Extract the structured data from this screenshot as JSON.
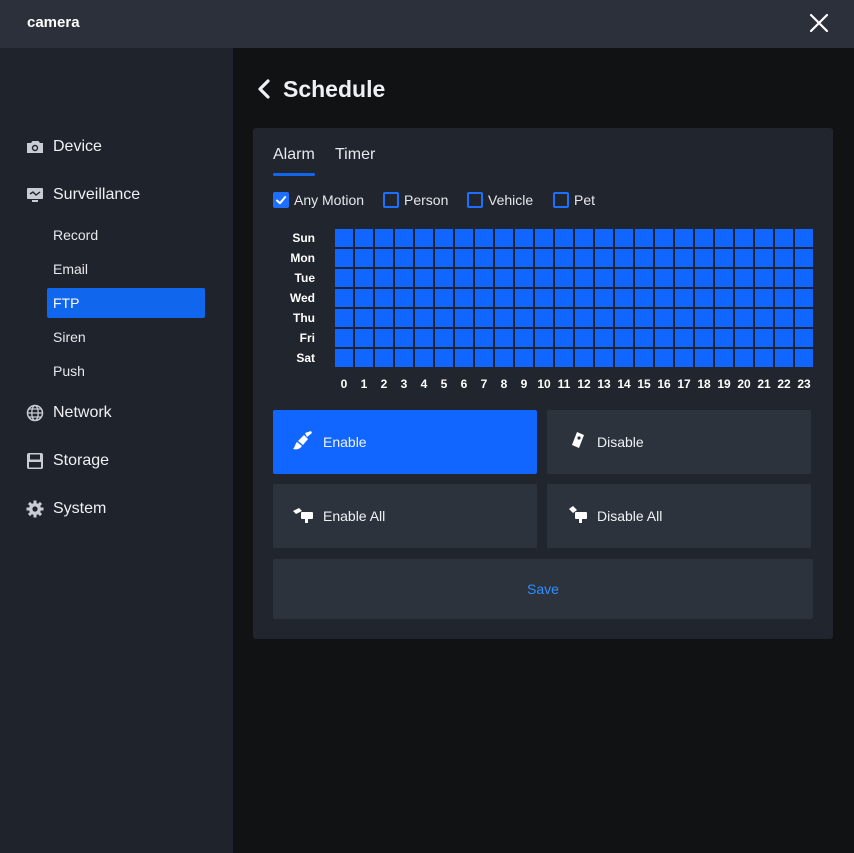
{
  "window": {
    "title": "camera"
  },
  "sidebar": {
    "items": [
      {
        "label": "Device",
        "icon": "camera-icon"
      },
      {
        "label": "Surveillance",
        "icon": "monitor-icon"
      },
      {
        "label": "Network",
        "icon": "globe-icon"
      },
      {
        "label": "Storage",
        "icon": "floppy-disk-icon"
      },
      {
        "label": "System",
        "icon": "gear-icon"
      }
    ],
    "subitems": [
      {
        "label": "Record",
        "active": false
      },
      {
        "label": "Email",
        "active": false
      },
      {
        "label": "FTP",
        "active": true
      },
      {
        "label": "Siren",
        "active": false
      },
      {
        "label": "Push",
        "active": false
      }
    ]
  },
  "page": {
    "title": "Schedule"
  },
  "tabs": [
    {
      "label": "Alarm",
      "active": true
    },
    {
      "label": "Timer",
      "active": false
    }
  ],
  "filters": [
    {
      "label": "Any Motion",
      "checked": true
    },
    {
      "label": "Person",
      "checked": false
    },
    {
      "label": "Vehicle",
      "checked": false
    },
    {
      "label": "Pet",
      "checked": false
    }
  ],
  "schedule": {
    "days": [
      "Sun",
      "Mon",
      "Tue",
      "Wed",
      "Thu",
      "Fri",
      "Sat"
    ],
    "hours": [
      "0",
      "1",
      "2",
      "3",
      "4",
      "5",
      "6",
      "7",
      "8",
      "9",
      "10",
      "11",
      "12",
      "13",
      "14",
      "15",
      "16",
      "17",
      "18",
      "19",
      "20",
      "21",
      "22",
      "23"
    ],
    "all_selected": true
  },
  "actions": {
    "enable": "Enable",
    "disable": "Disable",
    "enable_all": "Enable All",
    "disable_all": "Disable All",
    "save": "Save"
  },
  "colors": {
    "accent": "#1166ff",
    "sidebar_bg": "#1f232b",
    "panel_bg": "#21252d",
    "button_bg": "#2d333d",
    "save_text": "#2d8fff"
  }
}
